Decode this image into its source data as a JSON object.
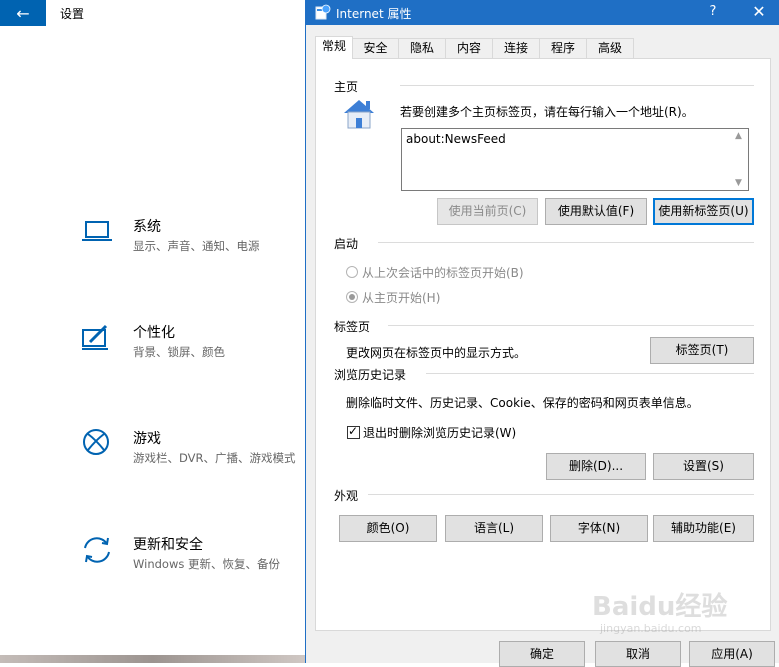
{
  "settings": {
    "title": "设置",
    "back_glyph": "←",
    "categories": [
      {
        "icon": "laptop-icon",
        "title": "系统",
        "desc": "显示、声音、通知、电源"
      },
      {
        "icon": "paint-brush-icon",
        "title": "个性化",
        "desc": "背景、锁屏、颜色"
      },
      {
        "icon": "xbox-icon",
        "title": "游戏",
        "desc": "游戏栏、DVR、广播、游戏模式"
      },
      {
        "icon": "sync-icon",
        "title": "更新和安全",
        "desc": "Windows 更新、恢复、备份"
      }
    ],
    "accent_color": "#0063b1"
  },
  "dialog": {
    "title": "Internet 属性",
    "help_glyph": "?",
    "close_glyph": "✕",
    "tabs": [
      "常规",
      "安全",
      "隐私",
      "内容",
      "连接",
      "程序",
      "高级"
    ],
    "home": {
      "label": "主页",
      "instruction": "若要创建多个主页标签页，请在每行输入一个地址(R)。",
      "url_value": "about:NewsFeed",
      "buttons": [
        "使用当前页(C)",
        "使用默认值(F)",
        "使用新标签页(U)"
      ]
    },
    "startup": {
      "label": "启动",
      "option1": "从上次会话中的标签页开始(B)",
      "option2": "从主页开始(H)"
    },
    "tabs_section": {
      "label": "标签页",
      "text": "更改网页在标签页中的显示方式。",
      "button": "标签页(T)"
    },
    "history": {
      "label": "浏览历史记录",
      "text": "删除临时文件、历史记录、Cookie、保存的密码和网页表单信息。",
      "checkbox_label": "退出时删除浏览历史记录(W)",
      "delete_button": "删除(D)...",
      "settings_button": "设置(S)"
    },
    "appearance": {
      "label": "外观",
      "buttons": [
        "颜色(O)",
        "语言(L)",
        "字体(N)",
        "辅助功能(E)"
      ]
    },
    "footer": [
      "确定",
      "取消",
      "应用(A)"
    ],
    "titlebar_color": "#1f6fc5"
  },
  "watermark": {
    "text": "Baidu经验",
    "sub": "jingyan.baidu.com"
  }
}
